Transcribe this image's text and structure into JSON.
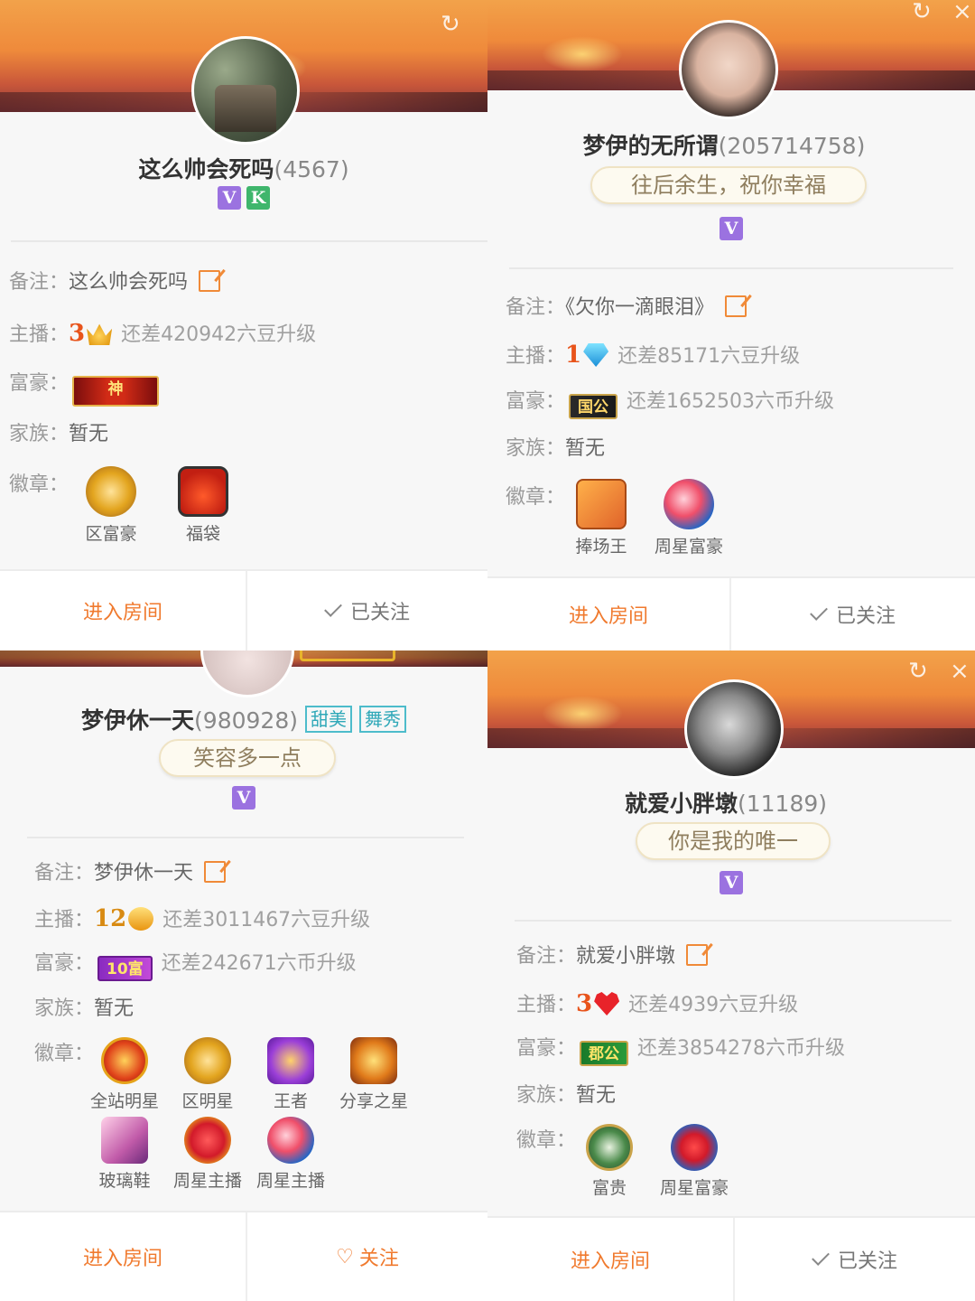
{
  "cards": [
    {
      "name": "这么帅会死吗",
      "uid": "(4567)",
      "badges": [
        "V",
        "K"
      ],
      "remark_label": "备注：",
      "remark": "这么帅会死吗",
      "anchor_label": "主播：",
      "anchor_level": "3",
      "anchor_hint": "还差420942六豆升级",
      "rich_label": "富豪：",
      "rich_badge": "神",
      "family_label": "家族：",
      "family": "暂无",
      "medal_label": "徽章：",
      "medals": [
        "区富豪",
        "福袋"
      ],
      "enter_label": "进入房间",
      "follow_label": "已关注"
    },
    {
      "name": "梦伊的无所谓",
      "uid": "(205714758)",
      "signature": "往后余生，祝你幸福",
      "badges": [
        "V"
      ],
      "remark_label": "备注：",
      "remark": "《欠你一滴眼泪》",
      "anchor_label": "主播：",
      "anchor_level": "1",
      "anchor_hint": "还差85171六豆升级",
      "rich_label": "富豪：",
      "rich_badge": "国公",
      "rich_hint": "还差1652503六币升级",
      "family_label": "家族：",
      "family": "暂无",
      "medal_label": "徽章：",
      "medals": [
        "捧场王",
        "周星富豪"
      ],
      "enter_label": "进入房间",
      "follow_label": "已关注"
    },
    {
      "name": "梦伊休一天",
      "uid": "(980928)",
      "tags": [
        "甜美",
        "舞秀"
      ],
      "signature": "笑容多一点",
      "badges": [
        "V"
      ],
      "remark_label": "备注：",
      "remark": "梦伊休一天",
      "anchor_label": "主播：",
      "anchor_level": "12",
      "anchor_hint": "还差3011467六豆升级",
      "rich_label": "富豪：",
      "rich_badge": "10富",
      "rich_hint": "还差242671六币升级",
      "family_label": "家族：",
      "family": "暂无",
      "medal_label": "徽章：",
      "medals": [
        "全站明星",
        "区明星",
        "王者",
        "分享之星",
        "玻璃鞋",
        "周星主播",
        "周星主播"
      ],
      "enter_label": "进入房间",
      "follow_label": "关注"
    },
    {
      "name": "就爱小胖墩",
      "uid": "(11189)",
      "signature": "你是我的唯一",
      "badges": [
        "V"
      ],
      "remark_label": "备注：",
      "remark": "就爱小胖墩",
      "anchor_label": "主播：",
      "anchor_level": "3",
      "anchor_hint": "还差4939六豆升级",
      "rich_label": "富豪：",
      "rich_badge": "郡公",
      "rich_hint": "还差3854278六币升级",
      "family_label": "家族：",
      "family": "暂无",
      "medal_label": "徽章：",
      "medals": [
        "富贵",
        "周星富豪"
      ],
      "enter_label": "进入房间",
      "follow_label": "已关注"
    }
  ],
  "icons": {
    "refresh": "↻",
    "close": "×",
    "heart_outline": "♡"
  },
  "colors": {
    "accent": "#f07a2e",
    "vip": "#9b72e0",
    "knight": "#3fb66c"
  }
}
